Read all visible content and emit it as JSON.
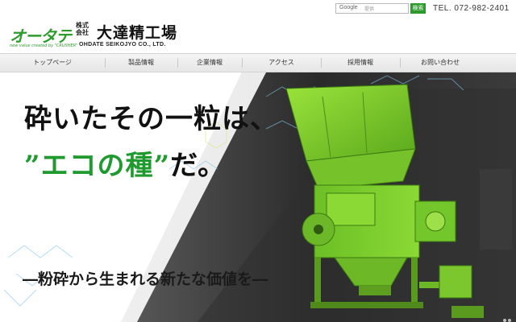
{
  "top": {
    "search_brand": "Google",
    "search_placeholder": "提供",
    "search_button": "検索",
    "tel": "TEL. 072-982-2401"
  },
  "logo": {
    "mark": "オータテ",
    "tagline": "new value created by \"CRUSHER\"",
    "kabushiki": "株式会社",
    "name_jp": "大達精工場",
    "name_en": "OHDATE SEIKOJYO CO., LTD."
  },
  "nav": {
    "items": [
      {
        "label": "トップページ"
      },
      {
        "label": "製品情報"
      },
      {
        "label": "企業情報"
      },
      {
        "label": "アクセス"
      },
      {
        "label": "採用情報"
      },
      {
        "label": "お問い合わせ"
      }
    ]
  },
  "hero": {
    "line1": "砕いたその一粒は、",
    "line2_quote_open": "”",
    "line2_em": "エコの種",
    "line2_quote_close": "”",
    "line2_tail": "だ。",
    "subtitle": "―粉砕から生まれる新たな価値を―"
  },
  "colors": {
    "brand_green": "#2e9c2d",
    "machine_green": "#7fd12b",
    "tagline_green": "#1e9a2e"
  }
}
